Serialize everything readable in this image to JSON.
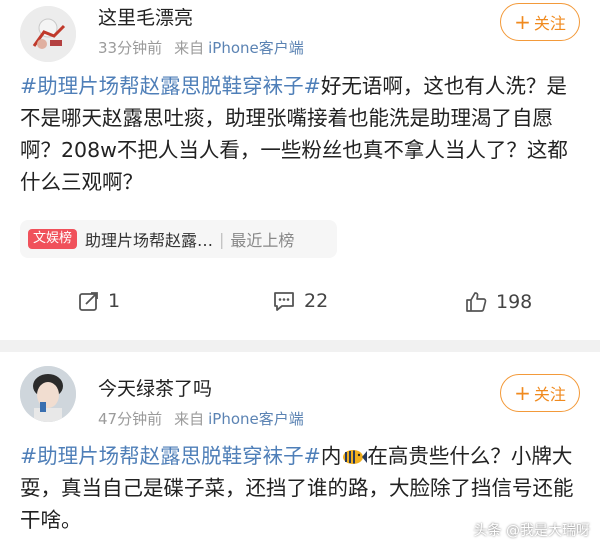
{
  "posts": [
    {
      "username": "这里毛漂亮",
      "time": "33分钟前",
      "source_prefix": "来自",
      "device": "iPhone客户端",
      "follow_label": "关注",
      "text_segments": [
        {
          "type": "tag",
          "text": "#助理片场帮赵露思脱鞋穿袜子#"
        },
        {
          "type": "text",
          "text": "好无语啊，这也有人洗？是不是哪天赵露思吐痰，助理张嘴接着也能洗是助理渴了自愿啊？208w不把人当人看，一些粉丝也真不拿人当人了？这都什么三观啊？"
        }
      ],
      "trend": {
        "badge": "文娱榜",
        "title": "助理片场帮赵露…",
        "rank": "最近上榜"
      },
      "actions": {
        "repost_count": "1",
        "comment_count": "22",
        "like_count": "198"
      }
    },
    {
      "username": "今天绿茶了吗",
      "time": "47分钟前",
      "source_prefix": "来自",
      "device": "iPhone客户端",
      "follow_label": "关注",
      "text_segments": [
        {
          "type": "tag",
          "text": "#助理片场帮赵露思脱鞋穿袜子#"
        },
        {
          "type": "text",
          "text": "内"
        },
        {
          "type": "text",
          "text": "在高贵些什么？小牌大耍，真当自己是碟子菜，还挡了谁的路，大脸除了挡信号还能干啥。"
        }
      ]
    }
  ],
  "watermark": "头条 @我是大瑞呀",
  "colors": {
    "tag": "#4f7fb8",
    "follow": "#f08a1e",
    "badge": "#f0515b",
    "meta": "#9b9b9b"
  }
}
